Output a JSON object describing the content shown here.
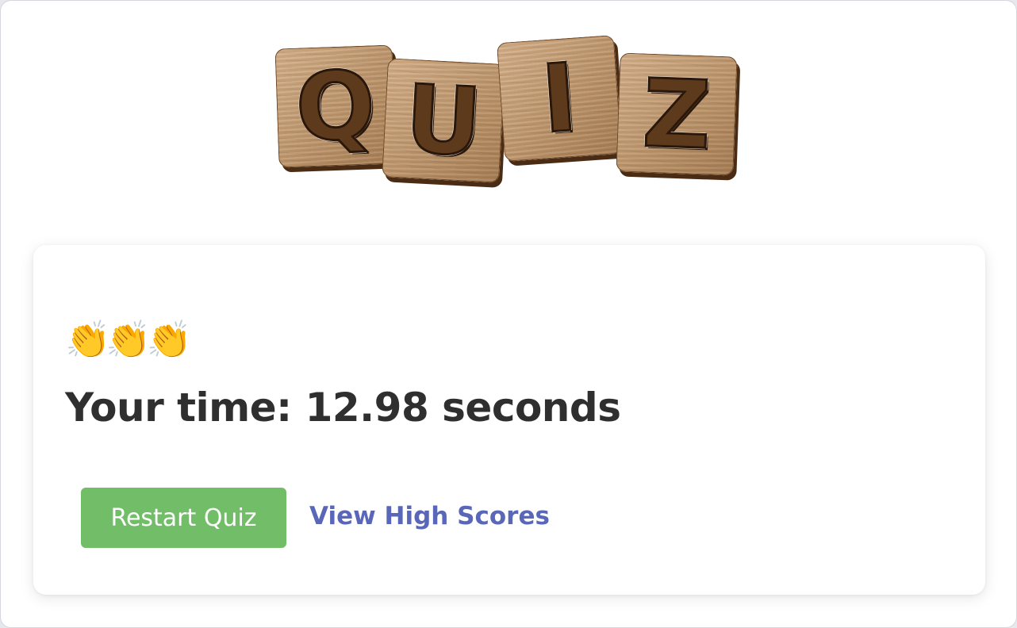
{
  "logo": {
    "letters": [
      "Q",
      "U",
      "I",
      "Z"
    ]
  },
  "result": {
    "emoji": "👏👏👏",
    "time_text": "Your time: 12.98 seconds"
  },
  "actions": {
    "restart_label": "Restart Quiz",
    "high_scores_label": "View High Scores"
  },
  "colors": {
    "restart_button": "#72bd67",
    "link": "#5a66b8",
    "tile_wood": "#c29c74",
    "tile_letter": "#5c3a1b"
  }
}
